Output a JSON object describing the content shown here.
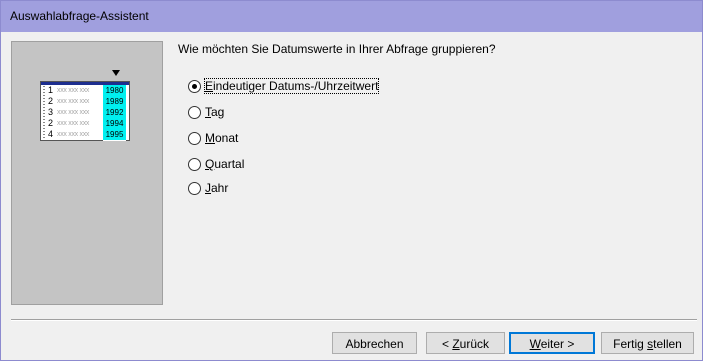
{
  "window": {
    "title": "Auswahlabfrage-Assistent"
  },
  "preview": {
    "rows": [
      {
        "num": "1",
        "xx": "xxx xxx xxx",
        "year": "1980"
      },
      {
        "num": "2",
        "xx": "xxx xxx xxx",
        "year": "1989"
      },
      {
        "num": "3",
        "xx": "xxx xxx xxx",
        "year": "1992"
      },
      {
        "num": "2",
        "xx": "xxx xxx xxx",
        "year": "1994"
      },
      {
        "num": "4",
        "xx": "xxx xxx xxx",
        "year": "1995"
      }
    ]
  },
  "question": "Wie möchten Sie Datumswerte in Ihrer Abfrage gruppieren?",
  "options": [
    {
      "mnemonic": "E",
      "rest": "indeutiger Datums-/Uhrzeitwert",
      "selected": true
    },
    {
      "mnemonic": "T",
      "rest": "ag",
      "selected": false
    },
    {
      "mnemonic": "M",
      "rest": "onat",
      "selected": false
    },
    {
      "mnemonic": "Q",
      "rest": "uartal",
      "selected": false
    },
    {
      "mnemonic": "J",
      "rest": "ahr",
      "selected": false
    }
  ],
  "buttons": {
    "cancel": {
      "label": "Abbrechen"
    },
    "back": {
      "prefix": "< ",
      "mnemonic": "Z",
      "rest": "urück"
    },
    "next": {
      "mnemonic": "W",
      "rest": "eiter >"
    },
    "finish": {
      "prefix": "Fertig ",
      "mnemonic": "s",
      "rest": "tellen"
    }
  },
  "colors": {
    "titlebar": "#a09fde",
    "year_highlight": "#00f0f0",
    "header_bar": "#1d2e8f"
  }
}
